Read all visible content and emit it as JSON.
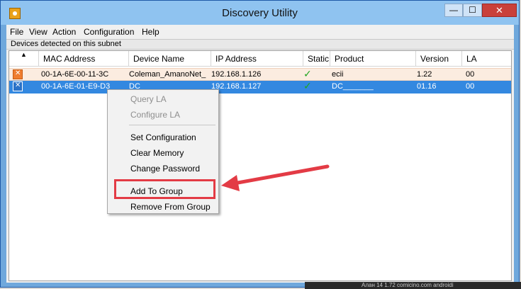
{
  "window": {
    "title": "Discovery Utility",
    "minimize_glyph": "—",
    "maximize_glyph": "☐",
    "close_glyph": "✕",
    "app_icon": "discovery-app-icon"
  },
  "menubar": {
    "items": [
      "File",
      "View",
      "Action",
      "Configuration",
      "Help"
    ]
  },
  "subnet_label": "Devices detected on this subnet",
  "table": {
    "sort_indicator": "▲",
    "columns": [
      "MAC Address",
      "Device Name",
      "IP Address",
      "Static",
      "Product",
      "Version",
      "LA"
    ],
    "rows": [
      {
        "icon": "device-icon-orange",
        "mac": "00-1A-6E-00-11-3C",
        "device_name": "Coleman_AmanoNet_",
        "ip": "192.168.1.126",
        "static": "✓",
        "product": "ecii",
        "version": "1.22",
        "la": "00",
        "selected": false
      },
      {
        "icon": "device-icon-blue",
        "mac": "00-1A-6E-01-E9-D3",
        "device_name": "DC",
        "ip": "192.168.1.127",
        "static": "✓",
        "product": "DC_______",
        "version": "01.16",
        "la": "00",
        "selected": true
      }
    ]
  },
  "context_menu": {
    "items": [
      {
        "label": "Query LA",
        "enabled": false
      },
      {
        "label": "Configure LA",
        "enabled": false
      },
      {
        "label": "Set Configuration",
        "enabled": true
      },
      {
        "label": "Clear Memory",
        "enabled": true
      },
      {
        "label": "Change Password",
        "enabled": true
      },
      {
        "label": "Add To Group",
        "enabled": true,
        "highlighted": true
      },
      {
        "label": "Remove From Group",
        "enabled": true
      }
    ]
  },
  "annotation": {
    "color": "#e33b45",
    "points_to": "Add To Group"
  },
  "taskbar": {
    "text": "Алан  14 1.72  comicino.com  androidi"
  },
  "colors": {
    "titlebar": "#8fc3f0",
    "selection": "#3388e0",
    "row_highlight": "#fbece0",
    "check": "#1fa51f"
  }
}
